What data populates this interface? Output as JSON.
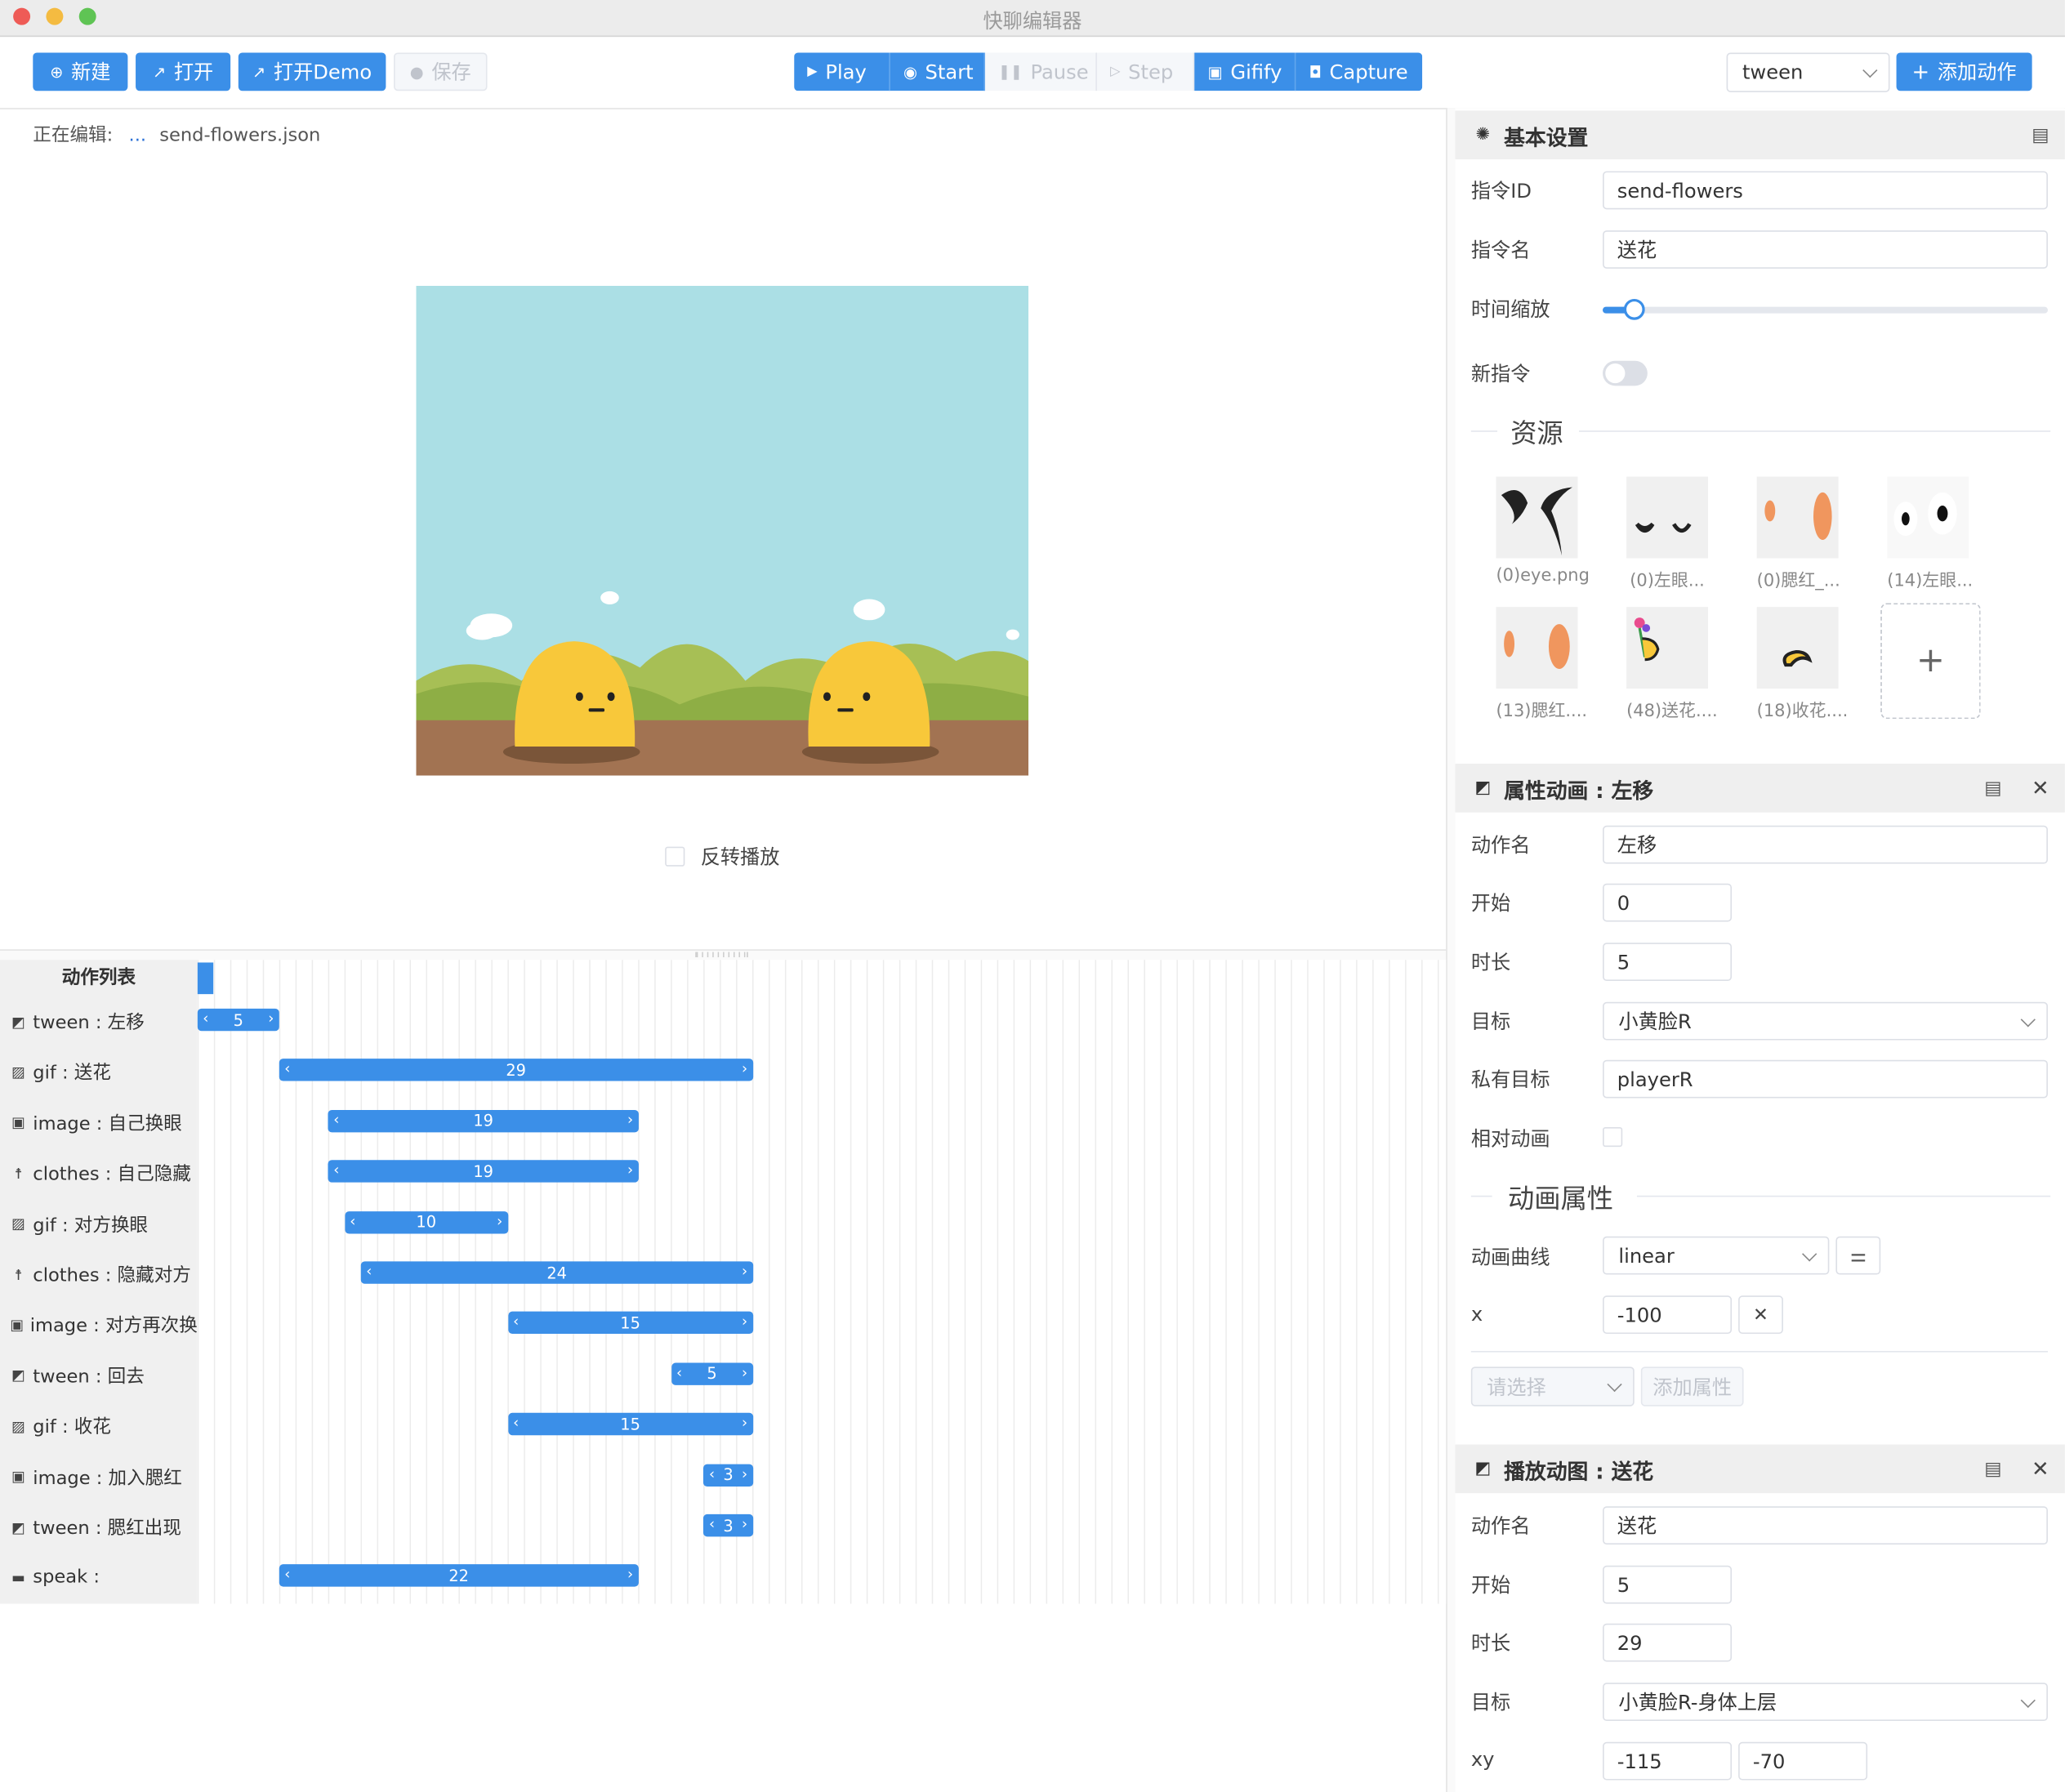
{
  "window": {
    "title": "快聊编辑器"
  },
  "toolbar": {
    "new_label": "新建",
    "open_label": "打开",
    "open_demo_label": "打开Demo",
    "save_label": "保存",
    "play_label": "Play",
    "start_label": "Start",
    "pause_label": "Pause",
    "step_label": "Step",
    "gifify_label": "Gifify",
    "capture_label": "Capture",
    "action_type_value": "tween",
    "add_action_label": "添加动作"
  },
  "editor": {
    "editing_label": "正在编辑:",
    "editing_dots": "...",
    "file_name": "send-flowers.json",
    "reverse_label": "反转播放"
  },
  "timeline": {
    "header": "动作列表",
    "rows": [
      {
        "icon": "tween-icon",
        "label": "tween : 左移",
        "start": 0,
        "duration": 5
      },
      {
        "icon": "gif-icon",
        "label": "gif : 送花",
        "start": 5,
        "duration": 29
      },
      {
        "icon": "image-icon",
        "label": "image : 自己换眼",
        "start": 8,
        "duration": 19
      },
      {
        "icon": "clothes-icon",
        "label": "clothes : 自己隐藏",
        "start": 8,
        "duration": 19
      },
      {
        "icon": "gif-icon",
        "label": "gif : 对方换眼",
        "start": 9,
        "duration": 10
      },
      {
        "icon": "clothes-icon",
        "label": "clothes : 隐藏对方",
        "start": 10,
        "duration": 24
      },
      {
        "icon": "image-icon",
        "label": "image : 对方再次换",
        "start": 19,
        "duration": 15
      },
      {
        "icon": "tween-icon",
        "label": "tween : 回去",
        "start": 29,
        "duration": 5
      },
      {
        "icon": "gif-icon",
        "label": "gif : 收花",
        "start": 19,
        "duration": 15
      },
      {
        "icon": "image-icon",
        "label": "image : 加入腮红",
        "start": 31,
        "duration": 3
      },
      {
        "icon": "tween-icon",
        "label": "tween : 腮红出现",
        "start": 31,
        "duration": 3
      },
      {
        "icon": "speak-icon",
        "label": "speak :",
        "start": 5,
        "duration": 22
      }
    ]
  },
  "basic": {
    "title": "基本设置",
    "id_label": "指令ID",
    "id_value": "send-flowers",
    "name_label": "指令名",
    "name_value": "送花",
    "scale_label": "时间缩放",
    "scale_value": 0.07,
    "new_label": "新指令",
    "new_on": false,
    "resources_title": "资源",
    "resources": [
      {
        "caption": "(0)eye.png"
      },
      {
        "caption": "(0)左眼..."
      },
      {
        "caption": "(0)腮红_..."
      },
      {
        "caption": "(14)左眼..."
      },
      {
        "caption": "(13)腮红...."
      },
      {
        "caption": "(48)送花...."
      },
      {
        "caption": "(18)收花...."
      }
    ],
    "add_resource": "+"
  },
  "tween_panel": {
    "title": "属性动画 : 左移",
    "name_label": "动作名",
    "name_value": "左移",
    "start_label": "开始",
    "start_value": "0",
    "duration_label": "时长",
    "duration_value": "5",
    "target_label": "目标",
    "target_value": "小黄脸R",
    "private_label": "私有目标",
    "private_value": "playerR",
    "relative_label": "相对动画",
    "anim_section": "动画属性",
    "curve_label": "动画曲线",
    "curve_value": "linear",
    "x_label": "x",
    "x_value": "-100",
    "select_placeholder": "请选择",
    "add_prop_label": "添加属性"
  },
  "gif_panel": {
    "title": "播放动图 : 送花",
    "name_label": "动作名",
    "name_value": "送花",
    "start_label": "开始",
    "start_value": "5",
    "duration_label": "时长",
    "duration_value": "29",
    "target_label": "目标",
    "target_value": "小黄脸R-身体上层",
    "xy_label": "xy",
    "x_value": "-115",
    "y_value": "-70"
  }
}
